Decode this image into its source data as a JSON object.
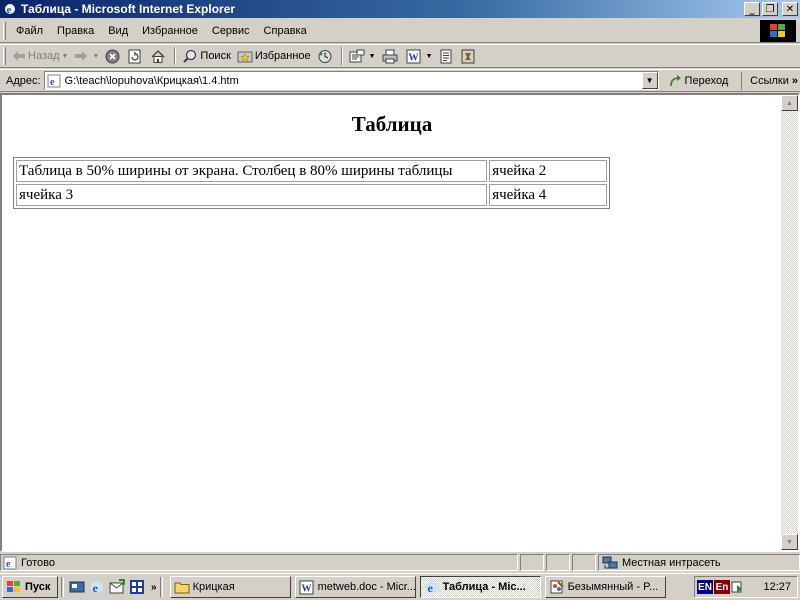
{
  "window": {
    "title": "Таблица - Microsoft Internet Explorer",
    "minimize": "_",
    "restore": "❐",
    "close": "✕"
  },
  "menu": [
    "Файл",
    "Правка",
    "Вид",
    "Избранное",
    "Сервис",
    "Справка"
  ],
  "toolbar": {
    "back": "Назад",
    "search": "Поиск",
    "favorites": "Избранное"
  },
  "address": {
    "label": "Адрес:",
    "value": "G:\\teach\\lopuhova\\Крицкая\\1.4.htm",
    "go": "Переход",
    "links": "Ссылки"
  },
  "page": {
    "heading": "Таблица",
    "table": {
      "rows": [
        [
          "Таблица в 50% ширины от экрана. Столбец в 80% ширины таблицы",
          "ячейка 2"
        ],
        [
          "ячейка 3",
          "ячейка 4"
        ]
      ]
    }
  },
  "status": {
    "text": "Готово",
    "zone": "Местная интрасеть"
  },
  "taskbar": {
    "start": "Пуск",
    "quicklaunch_more": "»",
    "tasks": [
      {
        "label": "Крицкая",
        "icon": "folder-icon",
        "active": false
      },
      {
        "label": "metweb.doc - Micr...",
        "icon": "word-doc-icon",
        "active": false
      },
      {
        "label": "Таблица - Mic...",
        "icon": "ie-icon",
        "active": true
      },
      {
        "label": "Безымянный - P...",
        "icon": "paint-icon",
        "active": false
      }
    ],
    "lang1": "EN",
    "lang2": "En",
    "clock": "12:27"
  }
}
